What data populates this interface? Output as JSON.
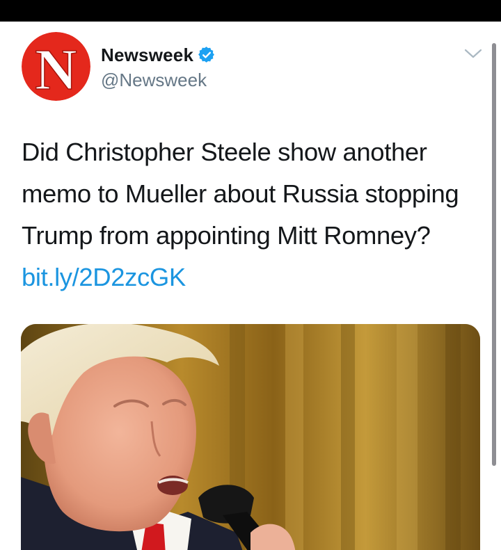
{
  "tweet": {
    "author": {
      "display_name": "Newsweek",
      "handle": "@Newsweek",
      "avatar_letter": "N",
      "verified": true
    },
    "text": "Did Christopher Steele show another memo to Mueller about Russia stopping Trump from appointing Mitt Romney?",
    "link_text": "bit.ly/2D2zcGK",
    "media": {
      "type": "photo"
    }
  },
  "colors": {
    "brand_red": "#e4281c",
    "link_blue": "#1b95e0",
    "verified_blue": "#1da1f2",
    "text_primary": "#14171a",
    "text_secondary": "#657786"
  },
  "icons": {
    "verified": "verified-badge-icon",
    "more": "chevron-down-icon"
  }
}
